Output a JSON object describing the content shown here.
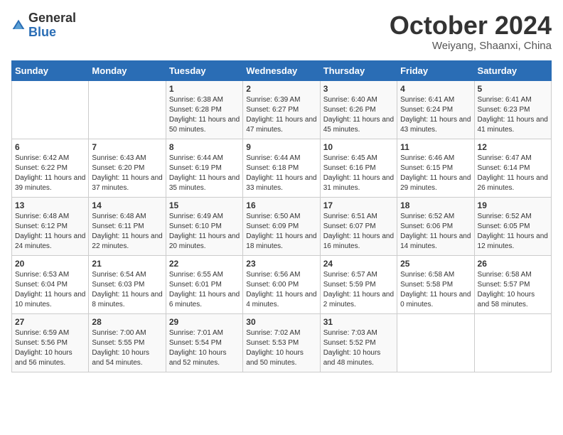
{
  "logo": {
    "general": "General",
    "blue": "Blue"
  },
  "title": "October 2024",
  "location": "Weiyang, Shaanxi, China",
  "days_of_week": [
    "Sunday",
    "Monday",
    "Tuesday",
    "Wednesday",
    "Thursday",
    "Friday",
    "Saturday"
  ],
  "weeks": [
    [
      {
        "day": "",
        "content": ""
      },
      {
        "day": "",
        "content": ""
      },
      {
        "day": "1",
        "content": "Sunrise: 6:38 AM\nSunset: 6:28 PM\nDaylight: 11 hours and 50 minutes."
      },
      {
        "day": "2",
        "content": "Sunrise: 6:39 AM\nSunset: 6:27 PM\nDaylight: 11 hours and 47 minutes."
      },
      {
        "day": "3",
        "content": "Sunrise: 6:40 AM\nSunset: 6:26 PM\nDaylight: 11 hours and 45 minutes."
      },
      {
        "day": "4",
        "content": "Sunrise: 6:41 AM\nSunset: 6:24 PM\nDaylight: 11 hours and 43 minutes."
      },
      {
        "day": "5",
        "content": "Sunrise: 6:41 AM\nSunset: 6:23 PM\nDaylight: 11 hours and 41 minutes."
      }
    ],
    [
      {
        "day": "6",
        "content": "Sunrise: 6:42 AM\nSunset: 6:22 PM\nDaylight: 11 hours and 39 minutes."
      },
      {
        "day": "7",
        "content": "Sunrise: 6:43 AM\nSunset: 6:20 PM\nDaylight: 11 hours and 37 minutes."
      },
      {
        "day": "8",
        "content": "Sunrise: 6:44 AM\nSunset: 6:19 PM\nDaylight: 11 hours and 35 minutes."
      },
      {
        "day": "9",
        "content": "Sunrise: 6:44 AM\nSunset: 6:18 PM\nDaylight: 11 hours and 33 minutes."
      },
      {
        "day": "10",
        "content": "Sunrise: 6:45 AM\nSunset: 6:16 PM\nDaylight: 11 hours and 31 minutes."
      },
      {
        "day": "11",
        "content": "Sunrise: 6:46 AM\nSunset: 6:15 PM\nDaylight: 11 hours and 29 minutes."
      },
      {
        "day": "12",
        "content": "Sunrise: 6:47 AM\nSunset: 6:14 PM\nDaylight: 11 hours and 26 minutes."
      }
    ],
    [
      {
        "day": "13",
        "content": "Sunrise: 6:48 AM\nSunset: 6:12 PM\nDaylight: 11 hours and 24 minutes."
      },
      {
        "day": "14",
        "content": "Sunrise: 6:48 AM\nSunset: 6:11 PM\nDaylight: 11 hours and 22 minutes."
      },
      {
        "day": "15",
        "content": "Sunrise: 6:49 AM\nSunset: 6:10 PM\nDaylight: 11 hours and 20 minutes."
      },
      {
        "day": "16",
        "content": "Sunrise: 6:50 AM\nSunset: 6:09 PM\nDaylight: 11 hours and 18 minutes."
      },
      {
        "day": "17",
        "content": "Sunrise: 6:51 AM\nSunset: 6:07 PM\nDaylight: 11 hours and 16 minutes."
      },
      {
        "day": "18",
        "content": "Sunrise: 6:52 AM\nSunset: 6:06 PM\nDaylight: 11 hours and 14 minutes."
      },
      {
        "day": "19",
        "content": "Sunrise: 6:52 AM\nSunset: 6:05 PM\nDaylight: 11 hours and 12 minutes."
      }
    ],
    [
      {
        "day": "20",
        "content": "Sunrise: 6:53 AM\nSunset: 6:04 PM\nDaylight: 11 hours and 10 minutes."
      },
      {
        "day": "21",
        "content": "Sunrise: 6:54 AM\nSunset: 6:03 PM\nDaylight: 11 hours and 8 minutes."
      },
      {
        "day": "22",
        "content": "Sunrise: 6:55 AM\nSunset: 6:01 PM\nDaylight: 11 hours and 6 minutes."
      },
      {
        "day": "23",
        "content": "Sunrise: 6:56 AM\nSunset: 6:00 PM\nDaylight: 11 hours and 4 minutes."
      },
      {
        "day": "24",
        "content": "Sunrise: 6:57 AM\nSunset: 5:59 PM\nDaylight: 11 hours and 2 minutes."
      },
      {
        "day": "25",
        "content": "Sunrise: 6:58 AM\nSunset: 5:58 PM\nDaylight: 11 hours and 0 minutes."
      },
      {
        "day": "26",
        "content": "Sunrise: 6:58 AM\nSunset: 5:57 PM\nDaylight: 10 hours and 58 minutes."
      }
    ],
    [
      {
        "day": "27",
        "content": "Sunrise: 6:59 AM\nSunset: 5:56 PM\nDaylight: 10 hours and 56 minutes."
      },
      {
        "day": "28",
        "content": "Sunrise: 7:00 AM\nSunset: 5:55 PM\nDaylight: 10 hours and 54 minutes."
      },
      {
        "day": "29",
        "content": "Sunrise: 7:01 AM\nSunset: 5:54 PM\nDaylight: 10 hours and 52 minutes."
      },
      {
        "day": "30",
        "content": "Sunrise: 7:02 AM\nSunset: 5:53 PM\nDaylight: 10 hours and 50 minutes."
      },
      {
        "day": "31",
        "content": "Sunrise: 7:03 AM\nSunset: 5:52 PM\nDaylight: 10 hours and 48 minutes."
      },
      {
        "day": "",
        "content": ""
      },
      {
        "day": "",
        "content": ""
      }
    ]
  ]
}
